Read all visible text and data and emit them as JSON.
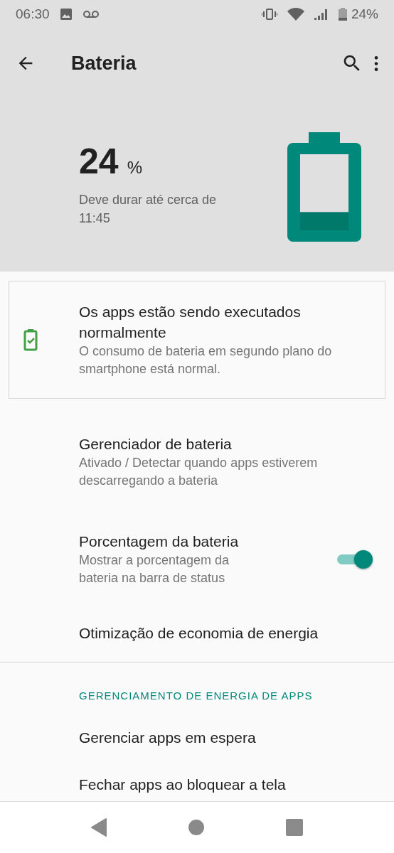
{
  "status_bar": {
    "time": "06:30",
    "battery": "24%"
  },
  "toolbar": {
    "title": "Bateria"
  },
  "summary": {
    "percent": "24",
    "unit": "%",
    "estimate": "Deve durar até cerca de 11:45",
    "level": 0.24
  },
  "tip_card": {
    "title": "Os apps estão sendo executados normalmente",
    "summary": "O consumo de bateria em segundo plano do smartphone está normal."
  },
  "preferences": [
    {
      "kind": "plain",
      "title": "Gerenciador de bateria",
      "summary": "Ativado / Detectar quando apps estiverem descarregando a bateria"
    },
    {
      "kind": "switch",
      "title": "Porcentagem da bateria",
      "summary": "Mostrar a porcentagem da bateria na barra de status",
      "on": true
    },
    {
      "kind": "plain",
      "title": "Otimização de economia de energia"
    }
  ],
  "section": {
    "header": "GERENCIAMENTO DE ENERGIA DE APPS",
    "items": [
      {
        "title": "Gerenciar apps em espera"
      },
      {
        "title": "Fechar apps ao bloquear a tela"
      }
    ]
  }
}
